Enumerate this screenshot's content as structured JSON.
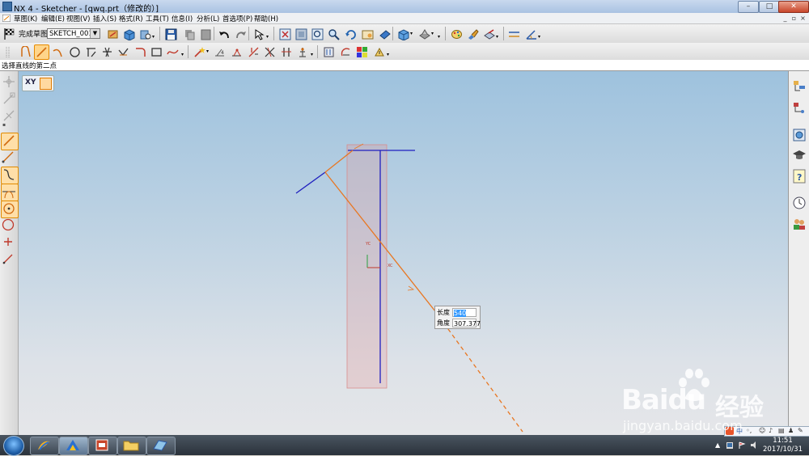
{
  "window": {
    "title": "NX 4 - Sketcher - [qwq.prt（修改的）]",
    "minimize": "–",
    "maximize": "□",
    "close": "✕"
  },
  "menubar": {
    "items": [
      "草图(K)",
      "编辑(E)",
      "视图(V)",
      "插入(S)",
      "格式(R)",
      "工具(T)",
      "信息(I)",
      "分析(L)",
      "首选项(P)",
      "帮助(H)"
    ],
    "mdi_minimize": "_",
    "mdi_restore": "▫",
    "mdi_close": "×"
  },
  "sketch_toolbar": {
    "finish_label": "完成草图",
    "sketch_name": "SKETCH_001"
  },
  "cue_line": {
    "text": "选择直线的第二点"
  },
  "viewport": {
    "plane_label": "XY",
    "dynamic_input": {
      "length_label": "长度",
      "length_value": "540",
      "angle_label": "角度",
      "angle_value": "307.377"
    },
    "axis_labels": {
      "yc": "YC",
      "xc": "XC"
    }
  },
  "taskbar": {
    "time": "11:51",
    "date": "2017/10/31",
    "ime": "中"
  },
  "watermark": {
    "brand": "Baidu",
    "brand_cn": "经验",
    "url": "jingyan.baidu.com"
  },
  "colors": {
    "accent_orange": "#e87722",
    "line_blue": "#1f1fbf",
    "selection_blue": "#3399ff"
  }
}
